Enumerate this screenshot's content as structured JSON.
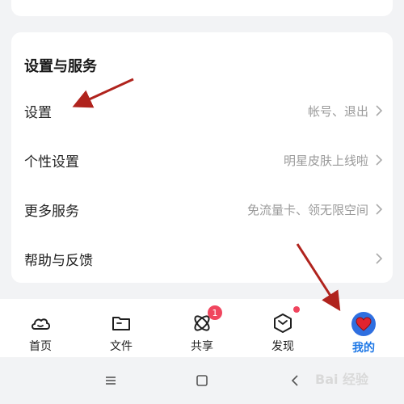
{
  "section": {
    "title": "设置与服务"
  },
  "rows": [
    {
      "label": "设置",
      "hint": "帐号、退出"
    },
    {
      "label": "个性设置",
      "hint": "明星皮肤上线啦"
    },
    {
      "label": "更多服务",
      "hint": "免流量卡、领无限空间"
    },
    {
      "label": "帮助与反馈",
      "hint": ""
    }
  ],
  "tabs": [
    {
      "label": "首页",
      "icon": "cloud-icon"
    },
    {
      "label": "文件",
      "icon": "folder-icon"
    },
    {
      "label": "共享",
      "icon": "share-orbit-icon",
      "badge": "1"
    },
    {
      "label": "发现",
      "icon": "discover-hexagon-icon"
    },
    {
      "label": "我的",
      "icon": "avatar-icon",
      "active": true
    }
  ],
  "watermark": "Bai 经验",
  "colors": {
    "accent": "#1e78e6",
    "badge": "#f0455e",
    "annotation": "#b0231d"
  }
}
